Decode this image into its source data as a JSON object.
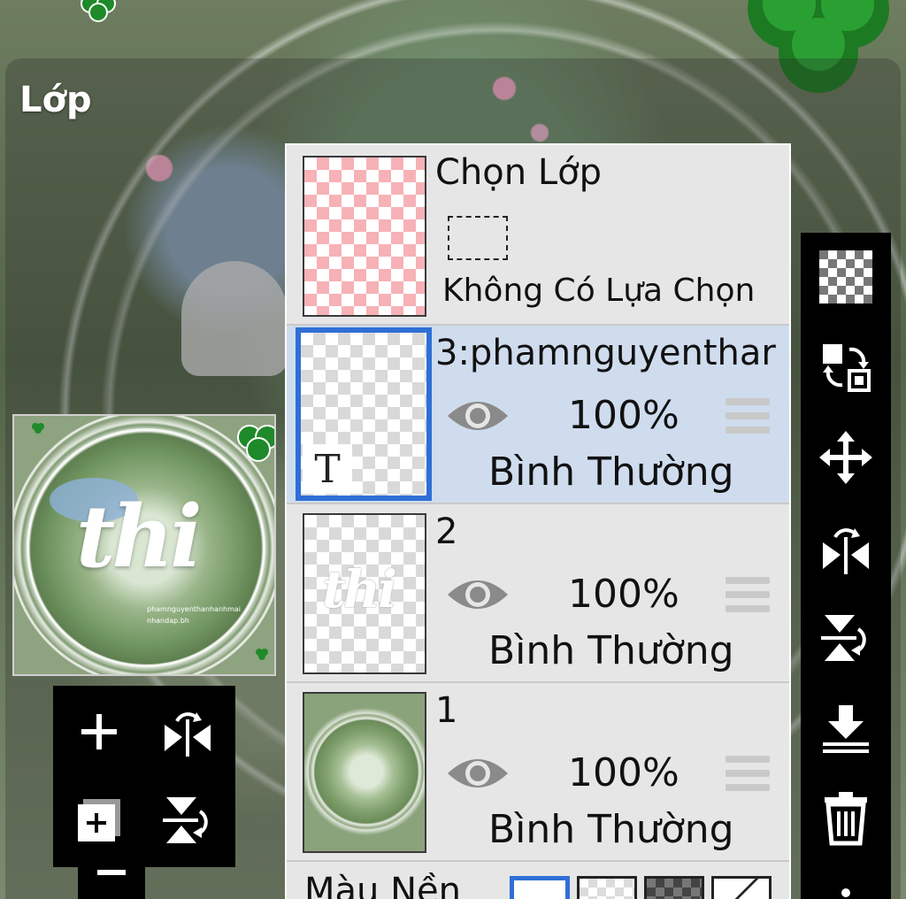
{
  "panel": {
    "title": "Lớp"
  },
  "selection_layer": {
    "title": "Chọn Lớp",
    "status": "Không Có Lựa Chọn"
  },
  "layers": [
    {
      "name": "3:phamnguyenthar",
      "opacity": "100%",
      "blend": "Bình Thường",
      "selected": true,
      "type": "text",
      "badge": "T"
    },
    {
      "name": "2",
      "opacity": "100%",
      "blend": "Bình Thường",
      "selected": false,
      "type": "image",
      "ghost_text": "thi"
    },
    {
      "name": "1",
      "opacity": "100%",
      "blend": "Bình Thường",
      "selected": false,
      "type": "photo"
    }
  ],
  "background_color": {
    "label": "Màu Nền"
  },
  "preview": {
    "word": "thi",
    "caption_line1": "phamnguyenthanhanhmai",
    "caption_line2": "nhandap.bh"
  },
  "left_toolbar": [
    "add-layer-icon",
    "flip-horizontal-icon",
    "duplicate-layer-icon",
    "flip-vertical-icon"
  ],
  "right_toolbar": [
    "transparency-icon",
    "swap-layer-icon",
    "move-icon",
    "flip-horizontal-icon",
    "flip-vertical-icon",
    "merge-down-icon",
    "delete-icon",
    "more-icon"
  ],
  "colors": {
    "accent": "#2f6fd6",
    "selected_row": "#cfdcee",
    "clover": "#1f7a1f"
  }
}
